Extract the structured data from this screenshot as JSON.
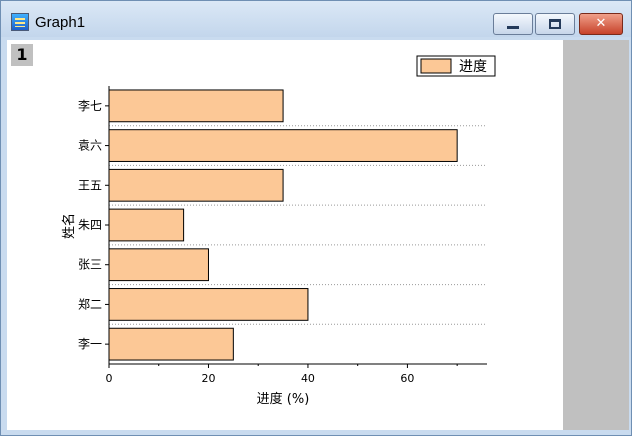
{
  "window": {
    "title": "Graph1",
    "layer_label": "1"
  },
  "colors": {
    "bar_fill": "#fcc896",
    "bar_stroke": "#000000"
  },
  "icons": {
    "app": "origin-graph-icon",
    "minimize": "minimize-icon",
    "maximize": "maximize-icon",
    "close": "close-icon"
  },
  "chart_data": {
    "type": "bar",
    "orientation": "horizontal",
    "categories": [
      "李七",
      "袁六",
      "王五",
      "朱四",
      "张三",
      "郑二",
      "李一"
    ],
    "series": [
      {
        "name": "进度",
        "values": [
          35,
          70,
          35,
          15,
          20,
          40,
          25
        ]
      }
    ],
    "xlabel": "进度 (%)",
    "ylabel": "姓名",
    "xlim": [
      0,
      76
    ],
    "xticks": [
      0,
      20,
      40,
      60
    ],
    "legend": "top-right",
    "grid": "dotted horizontal lines between categories"
  }
}
